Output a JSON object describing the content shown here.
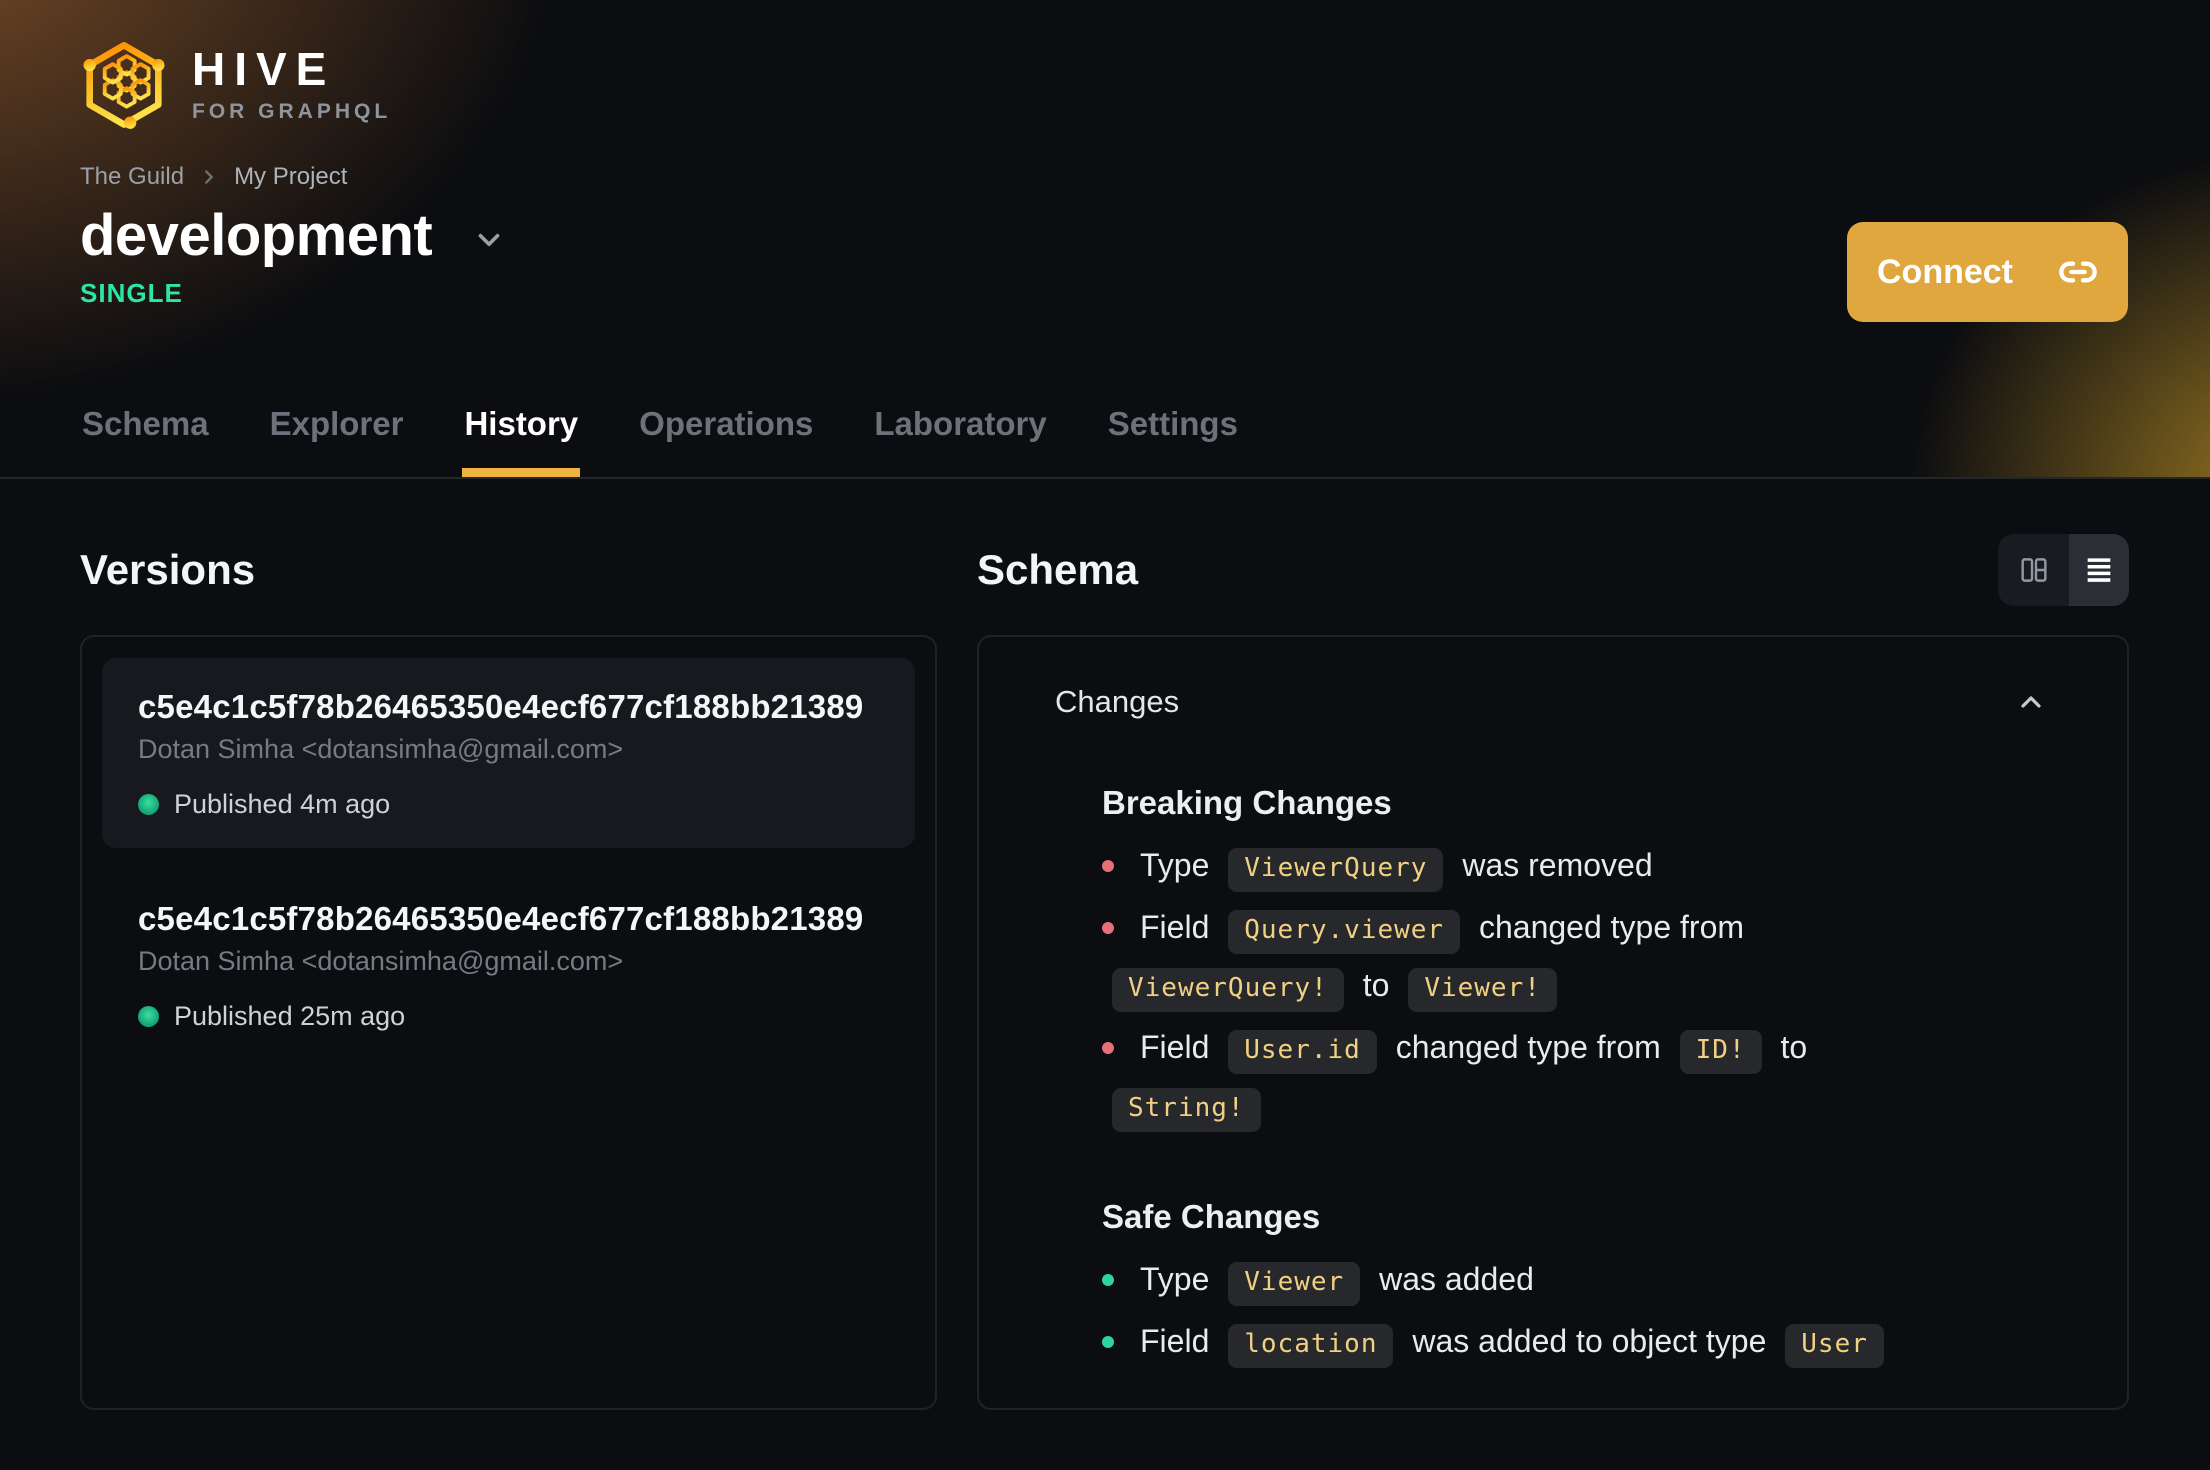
{
  "brand": {
    "name": "HIVE",
    "tagline": "FOR GRAPHQL"
  },
  "breadcrumb": {
    "items": [
      "The Guild",
      "My Project"
    ]
  },
  "target": {
    "name": "development",
    "badge": "SINGLE"
  },
  "connect": {
    "label": "Connect",
    "icon": "link-icon"
  },
  "tabs": [
    {
      "label": "Schema",
      "active": false
    },
    {
      "label": "Explorer",
      "active": false
    },
    {
      "label": "History",
      "active": true
    },
    {
      "label": "Operations",
      "active": false
    },
    {
      "label": "Laboratory",
      "active": false
    },
    {
      "label": "Settings",
      "active": false
    }
  ],
  "versions": {
    "title": "Versions",
    "items": [
      {
        "hash": "c5e4c1c5f78b26465350e4ecf677cf188bb21389",
        "author": "Dotan Simha <dotansimha@gmail.com>",
        "status": "Published 4m ago",
        "selected": true
      },
      {
        "hash": "c5e4c1c5f78b26465350e4ecf677cf188bb21389",
        "author": "Dotan Simha <dotansimha@gmail.com>",
        "status": "Published 25m ago",
        "selected": false
      }
    ]
  },
  "schema": {
    "title": "Schema",
    "changes_title": "Changes",
    "view_modes": [
      "split-view",
      "list-view"
    ],
    "active_view": "list-view",
    "sections": [
      {
        "title": "Breaking Changes",
        "kind": "breaking",
        "items": [
          [
            {
              "t": "text",
              "v": "Type"
            },
            {
              "t": "code",
              "v": "ViewerQuery"
            },
            {
              "t": "text",
              "v": "was removed"
            }
          ],
          [
            {
              "t": "text",
              "v": "Field"
            },
            {
              "t": "code",
              "v": "Query.viewer"
            },
            {
              "t": "text",
              "v": "changed type from"
            },
            {
              "t": "code",
              "v": "ViewerQuery!"
            },
            {
              "t": "text",
              "v": "to"
            },
            {
              "t": "code",
              "v": "Viewer!"
            }
          ],
          [
            {
              "t": "text",
              "v": "Field"
            },
            {
              "t": "code",
              "v": "User.id"
            },
            {
              "t": "text",
              "v": "changed type from"
            },
            {
              "t": "code",
              "v": "ID!"
            },
            {
              "t": "text",
              "v": "to"
            },
            {
              "t": "code",
              "v": "String!"
            }
          ]
        ]
      },
      {
        "title": "Safe Changes",
        "kind": "safe",
        "items": [
          [
            {
              "t": "text",
              "v": "Type"
            },
            {
              "t": "code",
              "v": "Viewer"
            },
            {
              "t": "text",
              "v": "was added"
            }
          ],
          [
            {
              "t": "text",
              "v": "Field"
            },
            {
              "t": "code",
              "v": "location"
            },
            {
              "t": "text",
              "v": "was added to object type"
            },
            {
              "t": "code",
              "v": "User"
            }
          ]
        ]
      }
    ]
  },
  "colors": {
    "accent_button": "#dfa73e",
    "tab_underline": "#efb33f",
    "badge_green": "#2ce5a6",
    "status_dot_green": "#18ab7c",
    "breaking_bullet": "#e5707a",
    "safe_bullet": "#2dd3a0",
    "chip_text": "#f0d083",
    "chip_background": "#26282c",
    "page_background": "#0b0d10"
  }
}
